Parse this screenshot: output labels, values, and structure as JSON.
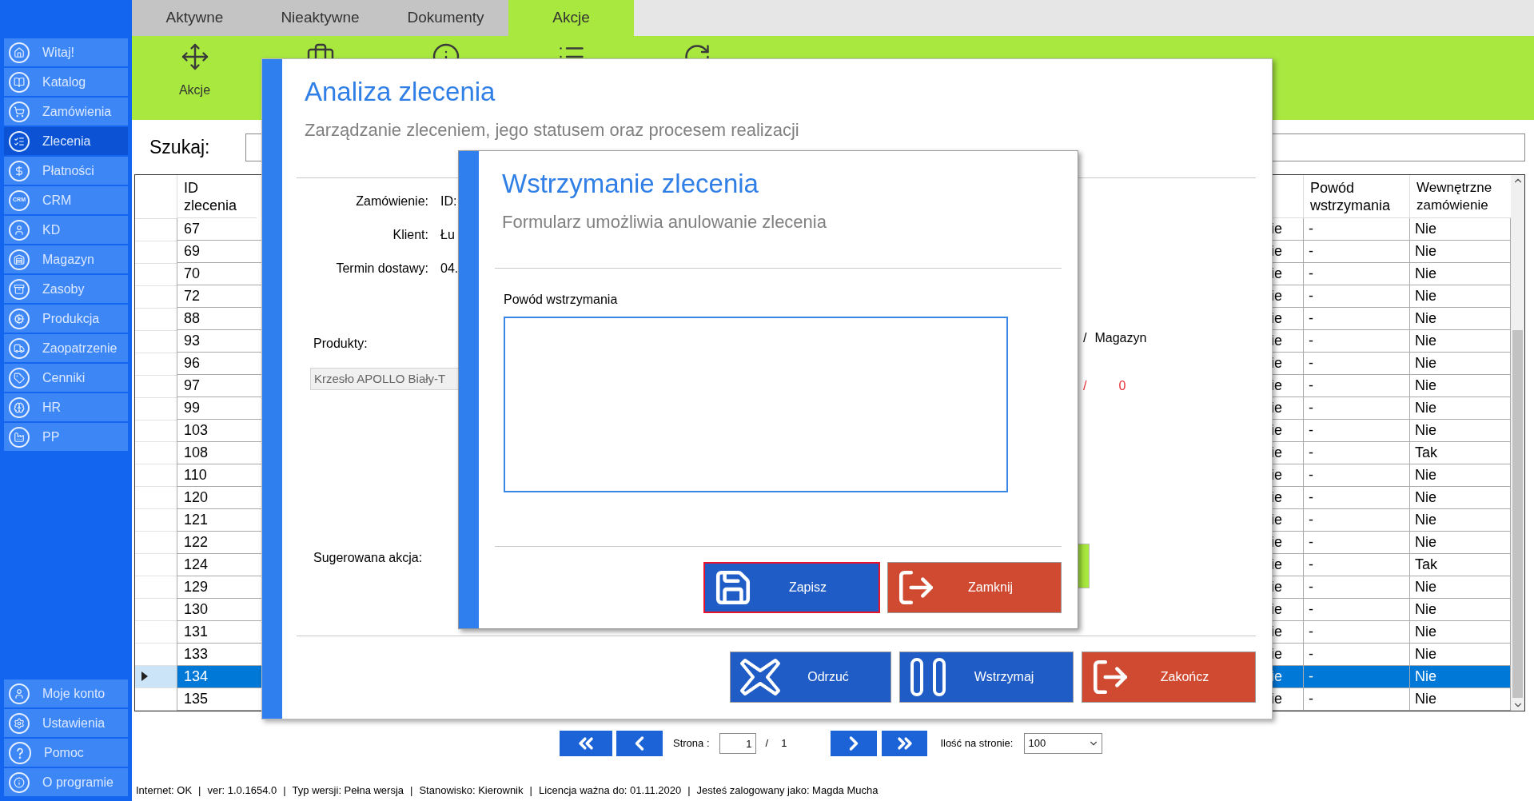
{
  "sidebar": {
    "items": [
      {
        "label": "Witaj!",
        "selected": false
      },
      {
        "label": "Katalog",
        "selected": false
      },
      {
        "label": "Zamówienia",
        "selected": false
      },
      {
        "label": "Zlecenia",
        "selected": true
      },
      {
        "label": "Płatności",
        "selected": false
      },
      {
        "label": "CRM",
        "selected": false,
        "icon_text": "CRM"
      },
      {
        "label": "KD",
        "selected": false
      },
      {
        "label": "Magazyn",
        "selected": false
      },
      {
        "label": "Zasoby",
        "selected": false
      },
      {
        "label": "Produkcja",
        "selected": false
      },
      {
        "label": "Zaopatrzenie",
        "selected": false
      },
      {
        "label": "Cenniki",
        "selected": false
      },
      {
        "label": "HR",
        "selected": false
      },
      {
        "label": "PP",
        "selected": false
      }
    ],
    "bottom_items": [
      {
        "label": "Moje konto"
      },
      {
        "label": "Ustawienia"
      },
      {
        "label": "Pomoc"
      },
      {
        "label": "O programie"
      }
    ]
  },
  "tabs": [
    {
      "label": "Aktywne",
      "selected": false
    },
    {
      "label": "Nieaktywne",
      "selected": false
    },
    {
      "label": "Dokumenty",
      "selected": false
    },
    {
      "label": "Akcje",
      "selected": true
    }
  ],
  "toolbar": {
    "label": "Akcje"
  },
  "search": {
    "label": "Szukaj:"
  },
  "table": {
    "columns": [
      {
        "label": "ID zlecenia"
      },
      {
        "label": "Powód wstrzymania"
      },
      {
        "label": "Wewnętrzne zamówienie"
      }
    ],
    "rows": [
      {
        "id": "67",
        "column_3": "ie",
        "reason": "-",
        "internal": "Nie",
        "selected": false
      },
      {
        "id": "69",
        "column_3": "ie",
        "reason": "-",
        "internal": "Nie",
        "selected": false
      },
      {
        "id": "70",
        "column_3": "ie",
        "reason": "-",
        "internal": "Nie",
        "selected": false
      },
      {
        "id": "72",
        "column_3": "ie",
        "reason": "-",
        "internal": "Nie",
        "selected": false
      },
      {
        "id": "88",
        "column_3": "ie",
        "reason": "-",
        "internal": "Nie",
        "selected": false
      },
      {
        "id": "93",
        "column_3": "ie",
        "reason": "-",
        "internal": "Nie",
        "selected": false
      },
      {
        "id": "96",
        "column_3": "ie",
        "reason": "-",
        "internal": "Nie",
        "selected": false
      },
      {
        "id": "97",
        "column_3": "ie",
        "reason": "-",
        "internal": "Nie",
        "selected": false
      },
      {
        "id": "99",
        "column_3": "ie",
        "reason": "-",
        "internal": "Nie",
        "selected": false
      },
      {
        "id": "103",
        "column_3": "ie",
        "reason": "-",
        "internal": "Nie",
        "selected": false
      },
      {
        "id": "108",
        "column_3": "ie",
        "reason": "-",
        "internal": "Tak",
        "selected": false
      },
      {
        "id": "110",
        "column_3": "ie",
        "reason": "-",
        "internal": "Nie",
        "selected": false
      },
      {
        "id": "120",
        "column_3": "ie",
        "reason": "-",
        "internal": "Nie",
        "selected": false
      },
      {
        "id": "121",
        "column_3": "ie",
        "reason": "-",
        "internal": "Nie",
        "selected": false
      },
      {
        "id": "122",
        "column_3": "ie",
        "reason": "-",
        "internal": "Nie",
        "selected": false
      },
      {
        "id": "124",
        "column_3": "ie",
        "reason": "-",
        "internal": "Tak",
        "selected": false
      },
      {
        "id": "129",
        "column_3": "ie",
        "reason": "-",
        "internal": "Nie",
        "selected": false
      },
      {
        "id": "130",
        "column_3": "ie",
        "reason": "-",
        "internal": "Nie",
        "selected": false
      },
      {
        "id": "131",
        "column_3": "ie",
        "reason": "-",
        "internal": "Nie",
        "selected": false
      },
      {
        "id": "133",
        "column_3": "ie",
        "reason": "-",
        "internal": "Nie",
        "selected": false
      },
      {
        "id": "134",
        "column_3": "ie",
        "reason": "-",
        "internal": "Nie",
        "selected": true
      },
      {
        "id": "135",
        "column_3": "ie",
        "reason": "-",
        "internal": "Nie",
        "selected": false
      }
    ]
  },
  "order_dialog": {
    "title": "Analiza zlecenia",
    "subtitle": "Zarządzanie zleceniem, jego statusem oraz procesem realizacji",
    "fields": [
      {
        "label": "Zamówienie:",
        "value": "ID:"
      },
      {
        "label": "Klient:",
        "value": "Łu"
      },
      {
        "label": "Termin dostawy:",
        "value": "04."
      }
    ],
    "products_label": "Produkty:",
    "product": "Krzesło APOLLO Biały-T",
    "stock_header": [
      "/",
      "Magazyn"
    ],
    "stock_values": [
      "/",
      "0"
    ],
    "suggested_label": "Sugerowana akcja:",
    "buttons": [
      {
        "label": "Odrzuć",
        "kind": "reject"
      },
      {
        "label": "Wstrzymaj",
        "kind": "hold"
      },
      {
        "label": "Zakończ",
        "kind": "exit"
      }
    ]
  },
  "hold_dialog": {
    "title": "Wstrzymanie zlecenia",
    "subtitle": "Formularz umożliwia anulowanie zlecenia",
    "field_label": "Powód wstrzymania",
    "buttons": [
      {
        "label": "Zapisz",
        "kind": "save",
        "focused": true
      },
      {
        "label": "Zamknij",
        "kind": "exit",
        "focused": false
      }
    ]
  },
  "pagination": {
    "page_label": "Strona :",
    "page": "1",
    "separator": "/",
    "total": "1",
    "per_page_label": "Ilość na stronie:",
    "per_page": "100"
  },
  "status_bar": {
    "separator": "|",
    "items": [
      "Internet: OK",
      "ver: 1.0.1654.0",
      "Typ wersji: Pełna wersja",
      "Stanowisko: Kierownik",
      "Licencja ważna do: 01.11.2020",
      "Jesteś zalogowany jako: Magda Mucha"
    ]
  }
}
